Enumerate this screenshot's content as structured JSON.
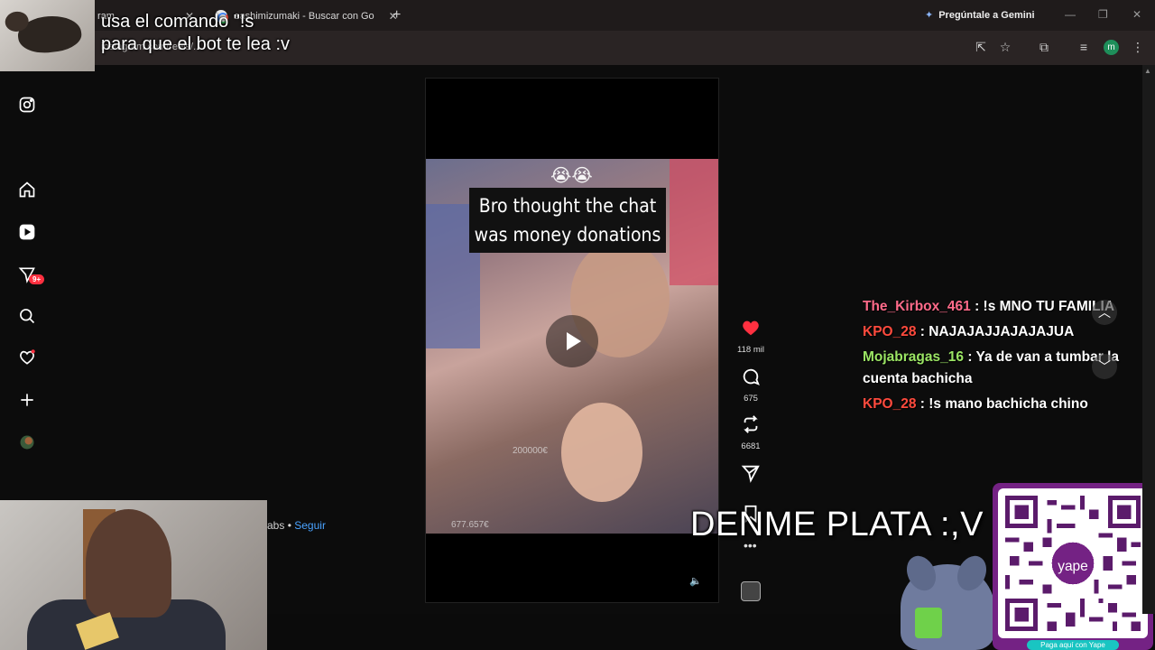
{
  "browser": {
    "tab1_title": "ram",
    "tab2_title": "sashimizumaki - Buscar con Go",
    "gemini_label": "Pregúntale a Gemini",
    "profile_initial": "m",
    "url_text": "instagram.com/reels/..."
  },
  "overlay": {
    "caption_line1": "usa el comando \"!s",
    "caption_line2": "para que el bot te lea :v",
    "bottom_caption": "DENME PLATA :,V"
  },
  "instagram": {
    "notification_count": "9+",
    "meme_text": "Bro thought the chat was money donations",
    "emoji": "😭😭",
    "overlay_amount_1": "200000€",
    "overlay_amount_2": "677.657€",
    "likes": "118 mil",
    "comments": "675",
    "reposts": "6681",
    "author_suffix": "abs",
    "follow_separator": "•",
    "follow_label": "Seguir"
  },
  "chat": [
    {
      "user": "The_Kirbox_461",
      "message": ": !s MNO TU FAMILIA",
      "color": "#ff6b8a"
    },
    {
      "user": "KPO_28",
      "message": ": NAJAJAJJAJAJAJUA",
      "color": "#ff4a3d"
    },
    {
      "user": "Mojabragas_16",
      "message": ": Ya de van a tumbar la cuenta bachicha",
      "color": "#9be564"
    },
    {
      "user": "KPO_28",
      "message": ": !s mano bachicha chino",
      "color": "#ff4a3d"
    }
  ],
  "yape": {
    "label": "Paga aquí con Yape",
    "brand": "yape"
  },
  "colors": {
    "accent_blue": "#4aa3ff",
    "like_red": "#ff3040",
    "yape_purple": "#742284"
  }
}
